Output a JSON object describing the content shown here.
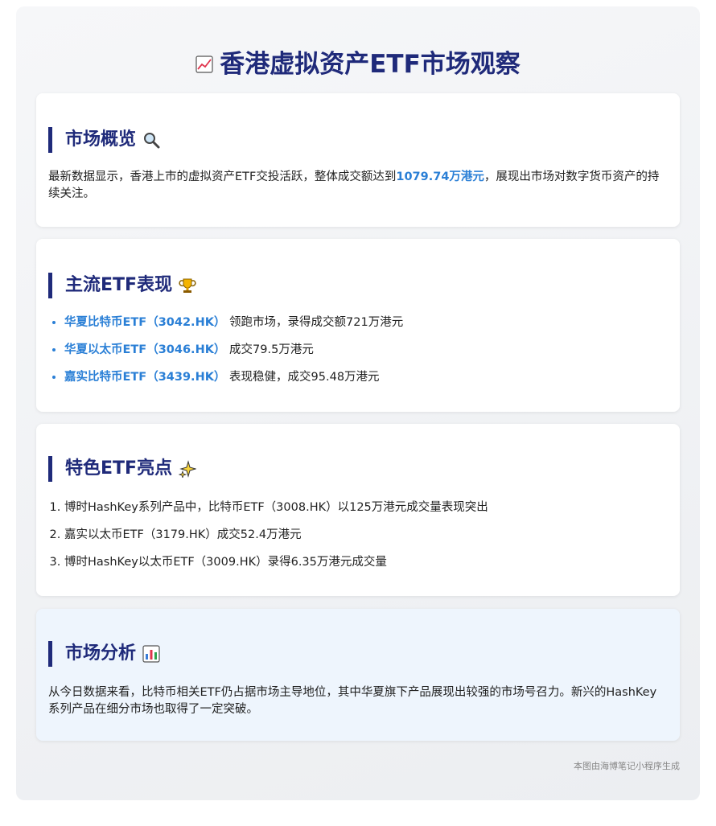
{
  "title": "香港虚拟资产ETF市场观察",
  "overview": {
    "heading": "市场概览",
    "text_before": "最新数据显示，香港上市的虚拟资产ETF交投活跃，整体成交额达到",
    "highlight": "1079.74万港元",
    "text_after": "，展现出市场对数字货币资产的持续关注。"
  },
  "mainstream": {
    "heading": "主流ETF表现",
    "items": [
      {
        "name": "华夏比特币ETF（3042.HK）",
        "desc": "领跑市场，录得成交额721万港元"
      },
      {
        "name": "华夏以太币ETF（3046.HK）",
        "desc": "成交79.5万港元"
      },
      {
        "name": "嘉实比特币ETF（3439.HK）",
        "desc": "表现稳健，成交95.48万港元"
      }
    ]
  },
  "featured": {
    "heading": "特色ETF亮点",
    "items": [
      "博时HashKey系列产品中，比特币ETF（3008.HK）以125万港元成交量表现突出",
      "嘉实以太币ETF（3179.HK）成交52.4万港元",
      "博时HashKey以太币ETF（3009.HK）录得6.35万港元成交量"
    ]
  },
  "analysis": {
    "heading": "市场分析",
    "text": "从今日数据来看，比特币相关ETF仍占据市场主导地位，其中华夏旗下产品展现出较强的市场号召力。新兴的HashKey系列产品在细分市场也取得了一定突破。"
  },
  "footer": "本图由海博笔记小程序生成",
  "colors": {
    "accent": "#1f2a7a",
    "highlight": "#2a7fd6"
  }
}
